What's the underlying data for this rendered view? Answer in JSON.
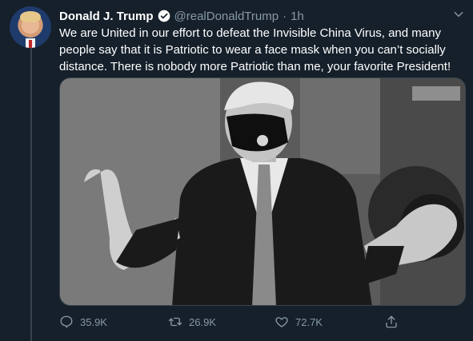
{
  "tweet": {
    "author_name": "Donald J. Trump",
    "handle": "@realDonaldTrump",
    "separator": "·",
    "time": "1h",
    "text": "We are United in our effort to defeat the Invisible China Virus, and many people say that it is Patriotic to wear a face mask when you can’t socially distance. There is nobody more Patriotic than me, your favorite President!"
  },
  "icons": {
    "avatar": "profile-photo",
    "verified": "verified-badge-icon",
    "more": "chevron-down-icon",
    "media": "black-and-white-photo-man-in-face-mask"
  },
  "actions": {
    "reply_count": "35.9K",
    "retweet_count": "26.9K",
    "like_count": "72.7K"
  },
  "colors": {
    "background": "#15202b",
    "text": "#ffffff",
    "muted": "#8899a6",
    "accent": "#1da1f2",
    "divider": "#38444d"
  }
}
